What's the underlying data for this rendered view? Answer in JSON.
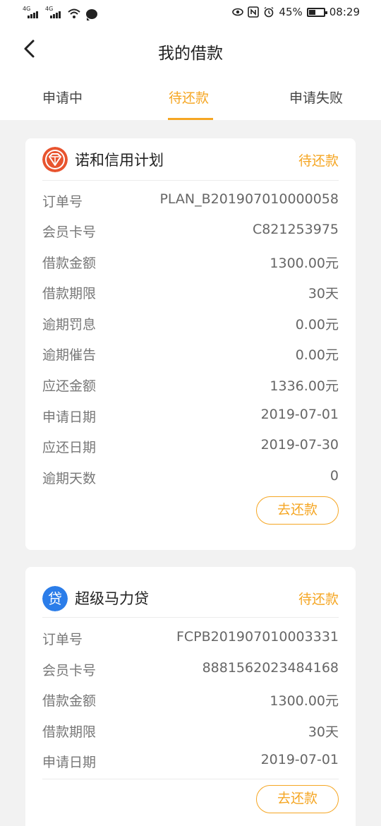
{
  "status_bar": {
    "signal1_label": "4G",
    "signal2_label": "4G",
    "battery_percent": "45%",
    "battery_level": 0.45,
    "time": "08:29"
  },
  "header": {
    "title": "我的借款",
    "back_icon": "chevron-left-icon"
  },
  "tabs": [
    {
      "label": "申请中",
      "active": false
    },
    {
      "label": "待还款",
      "active": true
    },
    {
      "label": "申请失败",
      "active": false
    }
  ],
  "colors": {
    "accent": "#f5a623",
    "logo1": "#e8542f",
    "logo2": "#2b7de9"
  },
  "loans": [
    {
      "name": "诺和信用计划",
      "status": "待还款",
      "logo_icon": "diamond-badge-icon",
      "rows": [
        {
          "label": "订单号",
          "value": "PLAN_B201907010000058"
        },
        {
          "label": "会员卡号",
          "value": "C821253975"
        },
        {
          "label": "借款金额",
          "value": "1300.00元"
        },
        {
          "label": "借款期限",
          "value": "30天"
        },
        {
          "label": "逾期罚息",
          "value": "0.00元"
        },
        {
          "label": "逾期催告",
          "value": "0.00元"
        },
        {
          "label": "应还金额",
          "value": "1336.00元"
        },
        {
          "label": "申请日期",
          "value": "2019-07-01"
        },
        {
          "label": "应还日期",
          "value": "2019-07-30"
        },
        {
          "label": "逾期天数",
          "value": "0"
        }
      ],
      "button": "去还款"
    },
    {
      "name": "超级马力贷",
      "status": "待还款",
      "logo_icon": "dai-badge-icon",
      "logo_text": "贷",
      "rows": [
        {
          "label": "订单号",
          "value": "FCPB201907010003331"
        },
        {
          "label": "会员卡号",
          "value": "8881562023484168"
        },
        {
          "label": "借款金额",
          "value": "1300.00元"
        },
        {
          "label": "借款期限",
          "value": "30天"
        },
        {
          "label": "申请日期",
          "value": "2019-07-01"
        }
      ],
      "button": "去还款"
    }
  ]
}
